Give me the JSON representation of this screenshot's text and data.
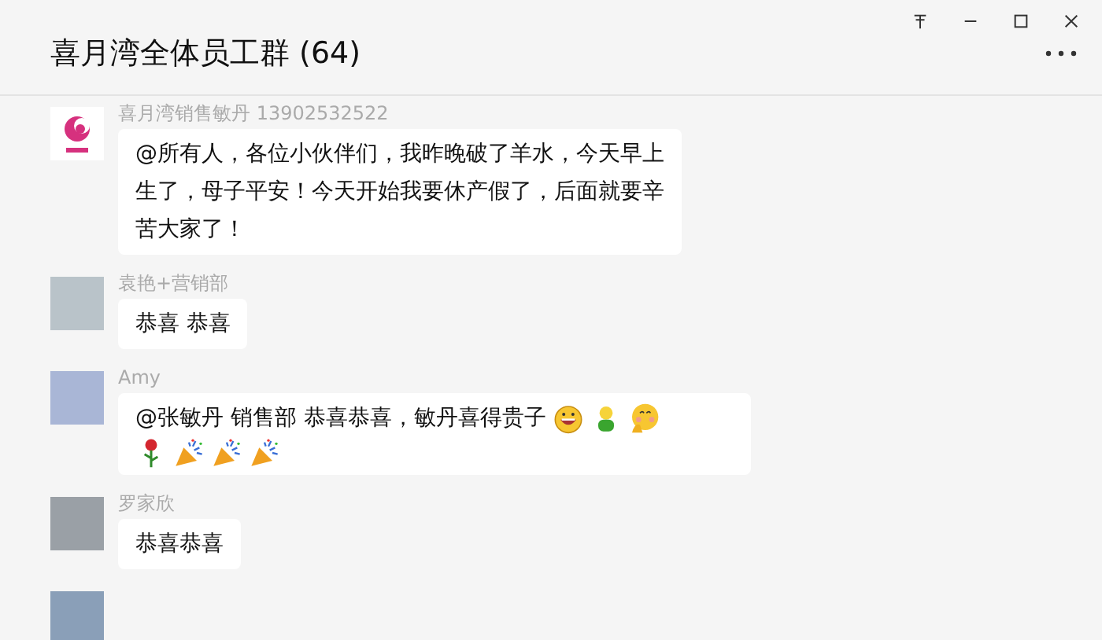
{
  "window": {
    "title": "喜月湾全体员工群 (64)"
  },
  "messages": [
    {
      "sender": "喜月湾销售敏丹 13902532522",
      "kind": "logo",
      "parts": [
        {
          "kind": "text",
          "text": "@所有人，各位小伙伴们，我昨晚破了羊水，今天早上生了，母子平安！今天开始我要休产假了，后面就要辛苦大家了！"
        }
      ]
    },
    {
      "sender": "袁艳+营销部",
      "kind": "photo",
      "parts": [
        {
          "kind": "text",
          "text": "恭喜 恭喜"
        }
      ]
    },
    {
      "sender": "Amy",
      "kind": "photo",
      "parts": [
        {
          "kind": "text",
          "text": "@张敏丹 销售部 恭喜恭喜，敏丹喜得贵子"
        },
        {
          "kind": "grin"
        },
        {
          "kind": "figure"
        },
        {
          "kind": "blush"
        },
        {
          "kind": "break"
        },
        {
          "kind": "rose"
        },
        {
          "kind": "popper"
        },
        {
          "kind": "popper"
        },
        {
          "kind": "popper"
        }
      ]
    },
    {
      "sender": "罗家欣",
      "kind": "photo",
      "parts": [
        {
          "kind": "text",
          "text": "恭喜恭喜"
        }
      ]
    },
    {
      "kind": "photo"
    }
  ]
}
